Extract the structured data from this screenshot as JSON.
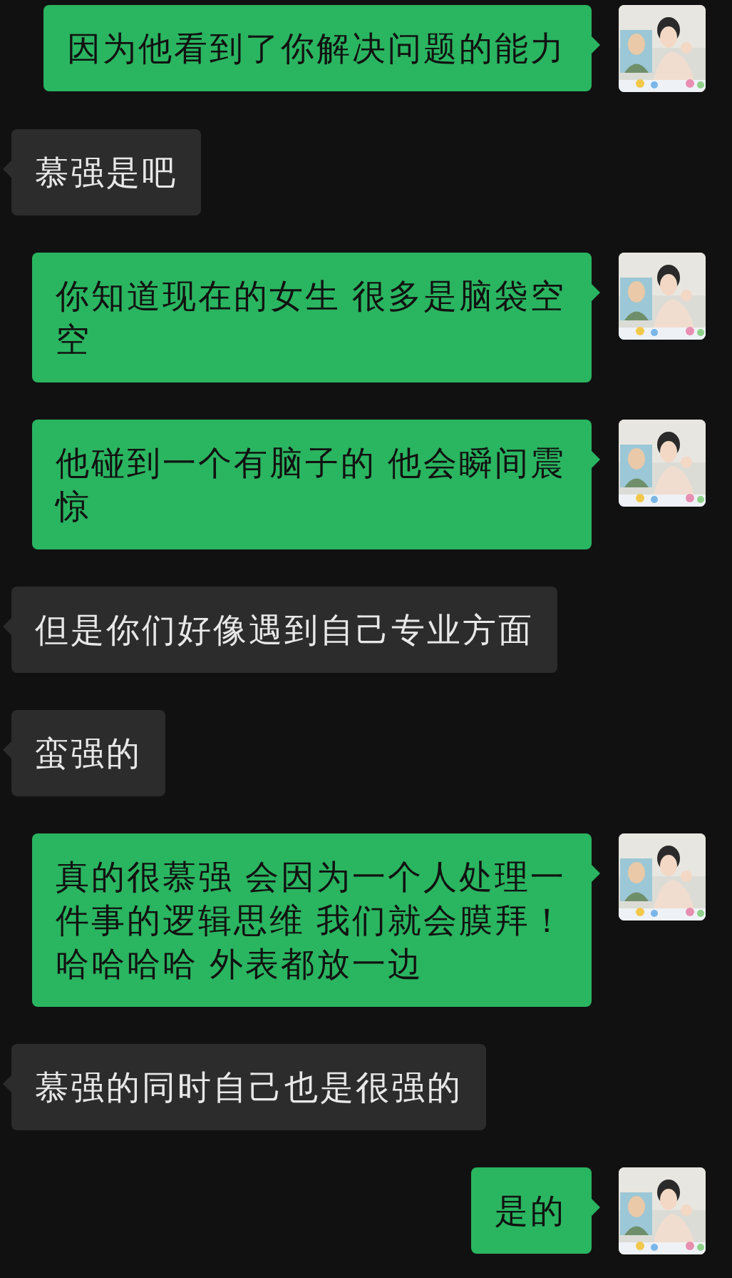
{
  "messages": [
    {
      "kind": "sent",
      "lines": [
        "因为他看到了你解决问题的能力"
      ]
    },
    {
      "kind": "received",
      "lines": [
        "慕强是吧"
      ]
    },
    {
      "kind": "sent",
      "lines": [
        "你知道现在的女生 很多是脑袋空",
        "空"
      ]
    },
    {
      "kind": "sent",
      "lines": [
        "他碰到一个有脑子的 他会瞬间震",
        "惊"
      ]
    },
    {
      "kind": "received",
      "lines": [
        "但是你们好像遇到自己专业方面"
      ]
    },
    {
      "kind": "received",
      "lines": [
        "蛮强的"
      ]
    },
    {
      "kind": "sent",
      "lines": [
        "真的很慕强 会因为一个人处理一",
        "件事的逻辑思维 我们就会膜拜！",
        "哈哈哈哈 外表都放一边"
      ]
    },
    {
      "kind": "received",
      "lines": [
        "慕强的同时自己也是很强的"
      ]
    },
    {
      "kind": "sent",
      "lines": [
        "是的"
      ]
    }
  ]
}
